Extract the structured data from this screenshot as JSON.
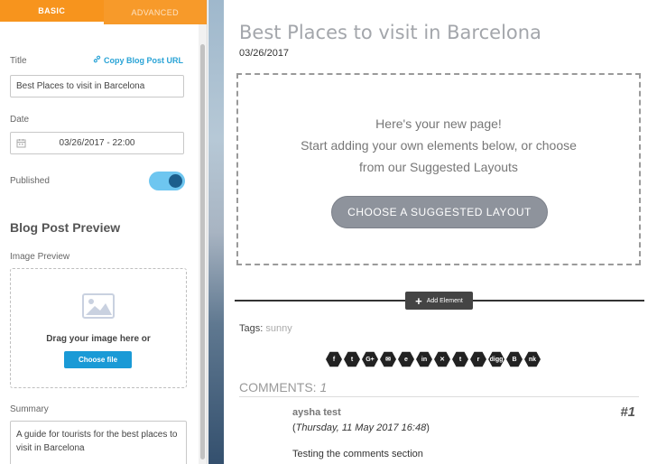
{
  "panel": {
    "tabs": [
      {
        "label": "BASIC"
      },
      {
        "label": "ADVANCED"
      }
    ],
    "title_label": "Title",
    "copy_url_label": "Copy Blog Post URL",
    "title_value": "Best Places to visit in Barcelona",
    "date_label": "Date",
    "date_value": "03/26/2017 - 22:00",
    "published_label": "Published",
    "published": true,
    "preview_heading": "Blog Post Preview",
    "image_preview_label": "Image Preview",
    "drop_text": "Drag your image here or",
    "choose_file_label": "Choose file",
    "summary_label": "Summary",
    "summary_value": "A guide for tourists for the best places to visit in Barcelona"
  },
  "page": {
    "title": "Best Places to visit in Barcelona",
    "date": "03/26/2017",
    "empty_lines": [
      "Here's your new page!",
      "Start adding your own elements below, or choose",
      "from our Suggested Layouts"
    ],
    "suggest_button": "CHOOSE A SUGGESTED LAYOUT",
    "add_element_label": "Add Element",
    "tags_label": "Tags:",
    "tags_value": "sunny",
    "share_icons": [
      {
        "name": "facebook-icon",
        "glyph": "f"
      },
      {
        "name": "twitter-icon",
        "glyph": "t"
      },
      {
        "name": "google-plus-icon",
        "glyph": "G+"
      },
      {
        "name": "email-icon",
        "glyph": "✉"
      },
      {
        "name": "evernote-icon",
        "glyph": "e"
      },
      {
        "name": "linkedin-icon",
        "glyph": "in"
      },
      {
        "name": "xing-icon",
        "glyph": "✕"
      },
      {
        "name": "tumblr-icon",
        "glyph": "t"
      },
      {
        "name": "reddit-icon",
        "glyph": "r"
      },
      {
        "name": "digg-icon",
        "glyph": "digg"
      },
      {
        "name": "blogger-icon",
        "glyph": "B"
      },
      {
        "name": "vk-icon",
        "glyph": "nk"
      }
    ],
    "comments_label": "COMMENTS:",
    "comments_count": "1",
    "comment": {
      "author": "aysha test",
      "number": "#1",
      "date_prefix": "(",
      "date": "Thursday, 11 May 2017 16:48",
      "date_suffix": ")",
      "text": "Testing the comments section"
    }
  },
  "colors": {
    "tab_bar": "#f7941d",
    "accent_link": "#29a3d6",
    "toggle_on": "#6ec6f0",
    "choose_file_button": "#1a9ad6",
    "suggest_button": "#8e939c"
  }
}
